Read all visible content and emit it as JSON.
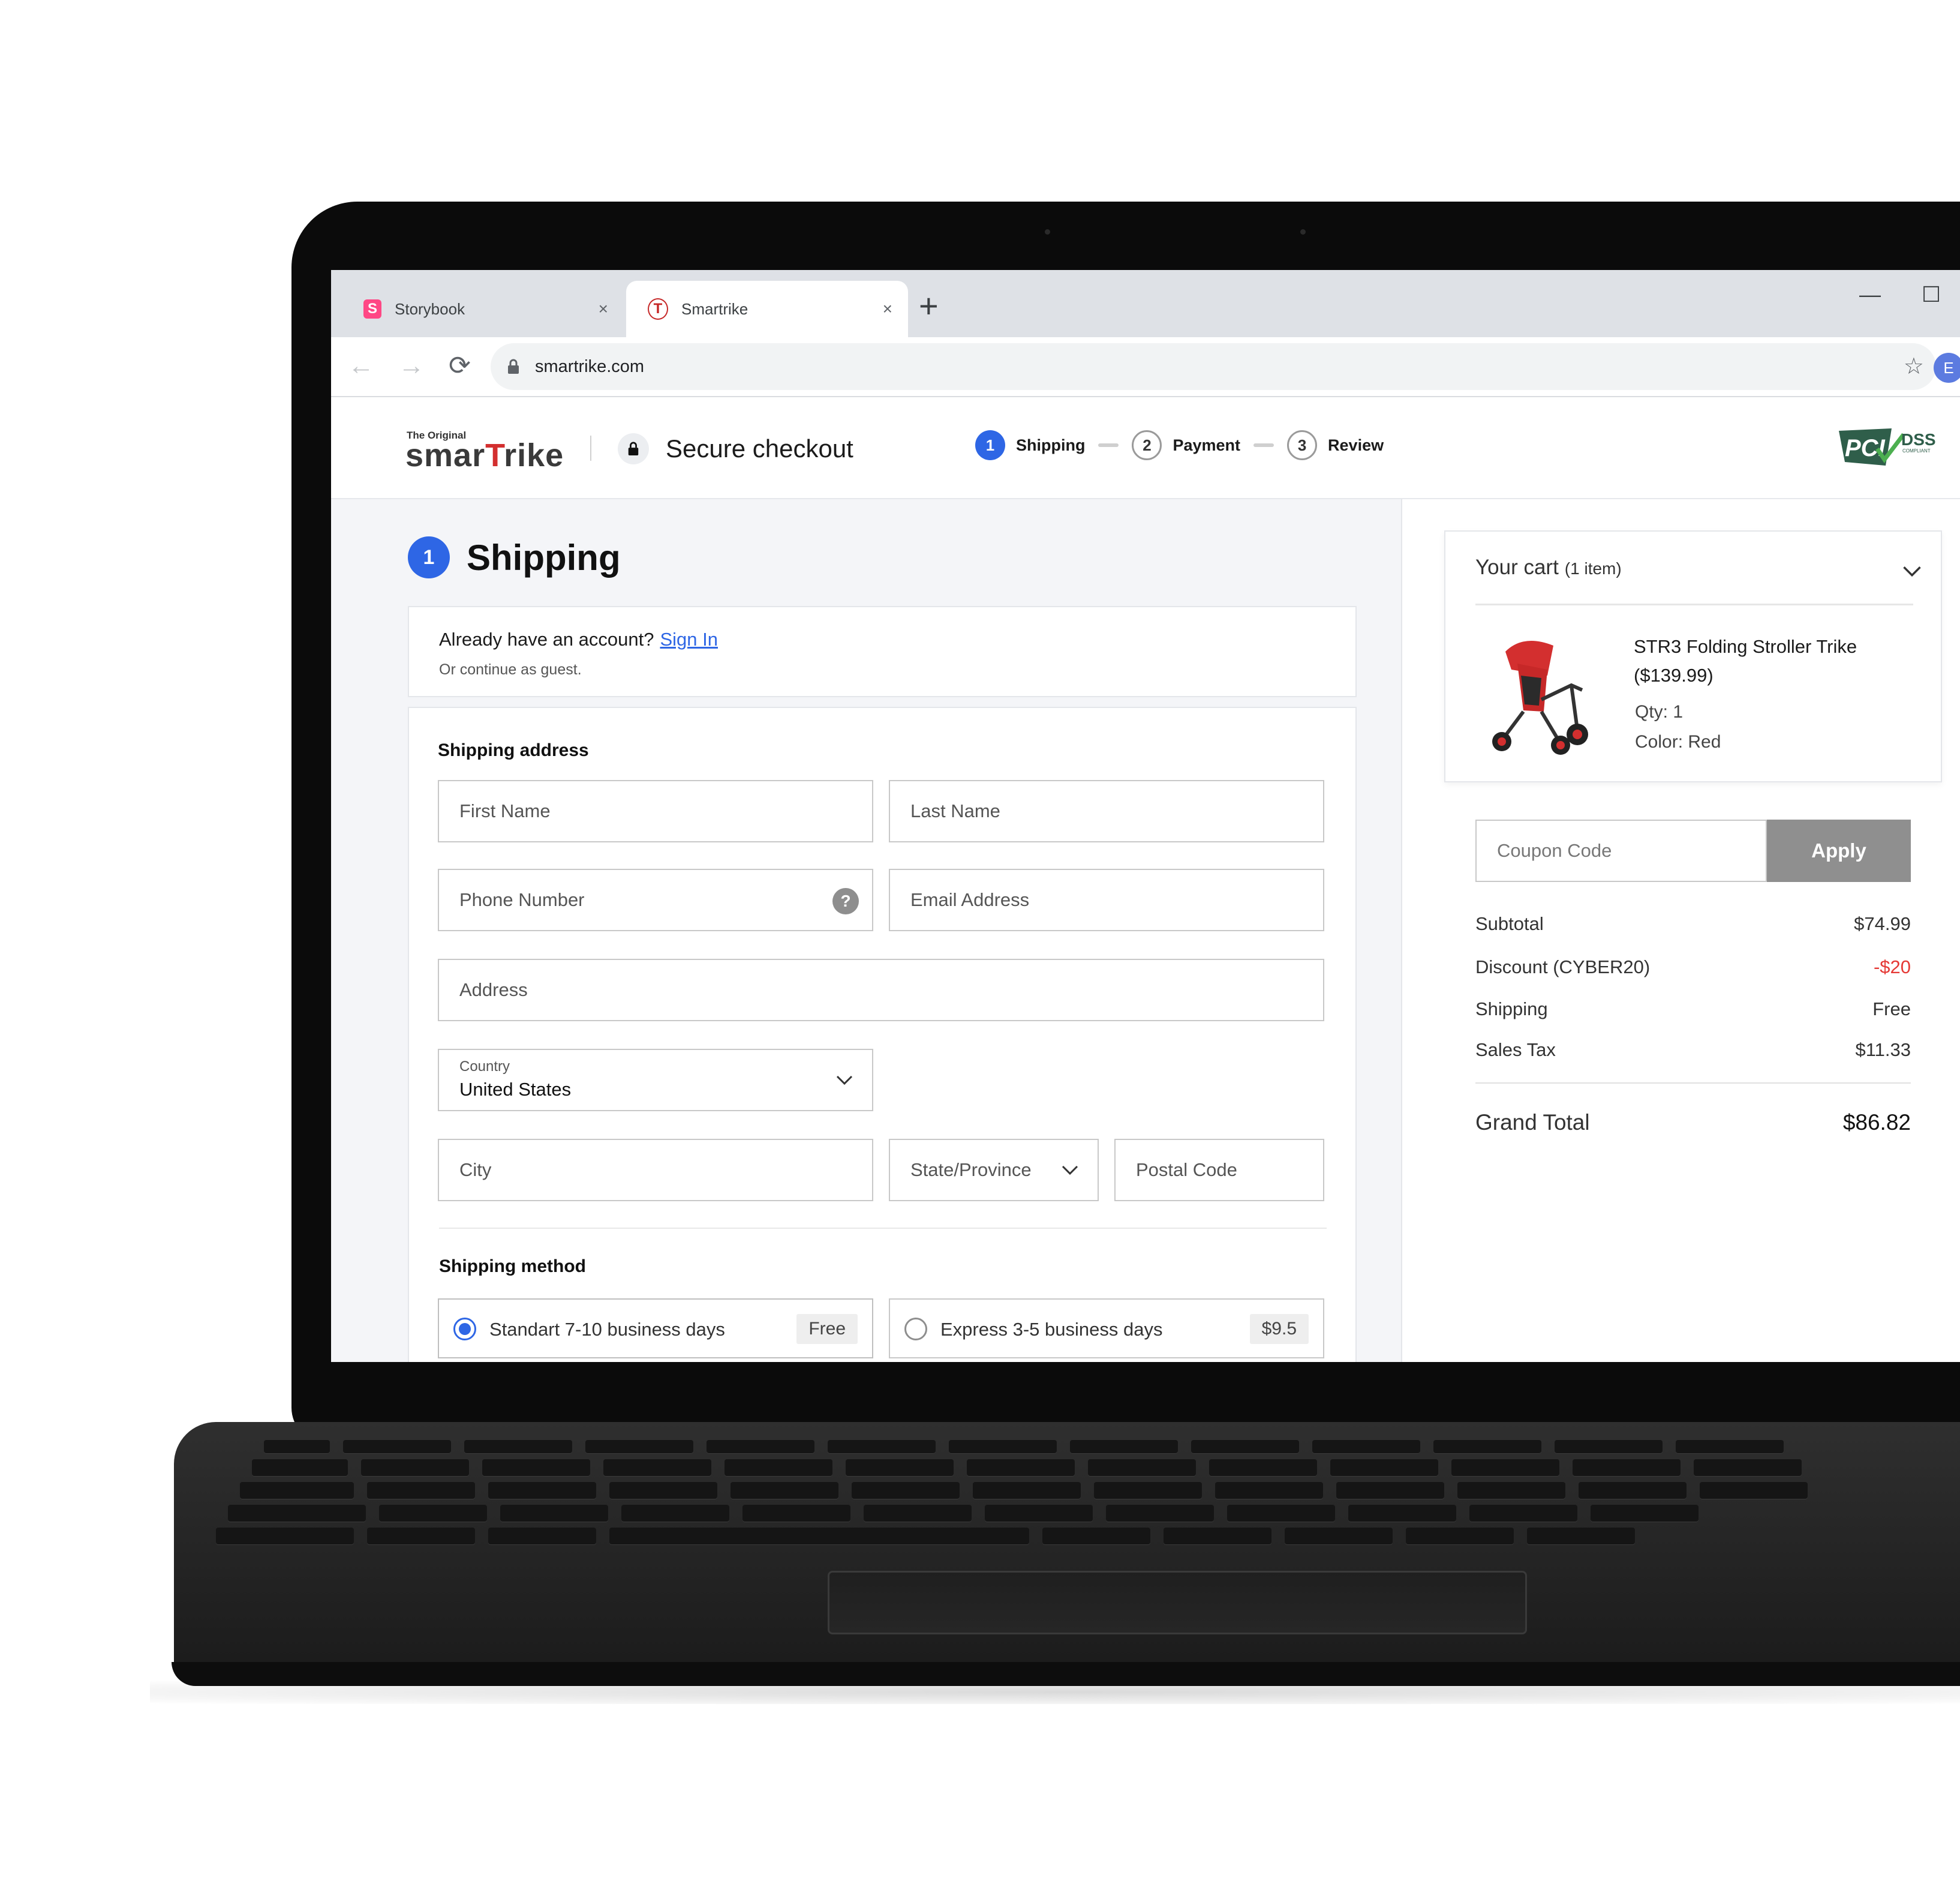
{
  "browser": {
    "tabs": [
      {
        "title": "Storybook",
        "icon": "storybook-icon",
        "favicon_letter": "S",
        "active": false
      },
      {
        "title": "Smartrike",
        "icon": "smartrike-icon",
        "favicon_letter": "T",
        "active": true
      }
    ],
    "new_tab_symbol": "+",
    "close_symbol": "×",
    "url": "smartrike.com",
    "profile_initial": "E"
  },
  "header": {
    "logo_tagline": "The Original",
    "logo_text_a": "smar",
    "logo_text_t": "T",
    "logo_text_b": "rike",
    "secure_checkout": "Secure checkout",
    "steps": [
      {
        "number": "1",
        "label": "Shipping",
        "active": true
      },
      {
        "number": "2",
        "label": "Payment",
        "active": false
      },
      {
        "number": "3",
        "label": "Review",
        "active": false
      }
    ],
    "pci_text": "PCI",
    "pci_dss": "DSS",
    "pci_compliant": "COMPLIANT"
  },
  "shipping": {
    "step_number": "1",
    "title": "Shipping",
    "account_prompt": "Already have an account?",
    "sign_in": "Sign In",
    "guest_text": "Or continue as guest.",
    "address_label": "Shipping address",
    "fields": {
      "first_name": "First Name",
      "last_name": "Last Name",
      "phone": "Phone Number",
      "email": "Email Address",
      "address": "Address",
      "country_label": "Country",
      "country_value": "United States",
      "city": "City",
      "state": "State/Province",
      "postal": "Postal Code"
    },
    "help_symbol": "?",
    "method_label": "Shipping method",
    "methods": [
      {
        "label": "Standart 7-10 business days",
        "price": "Free",
        "selected": true
      },
      {
        "label": "Express 3-5 business days",
        "price": "$9.5",
        "selected": false
      }
    ]
  },
  "cart": {
    "title": "Your cart",
    "count": "(1 item)",
    "item": {
      "name": "STR3 Folding Stroller Trike ($139.99)",
      "qty": "Qty: 1",
      "color": "Color: Red"
    },
    "coupon_placeholder": "Coupon Code",
    "apply": "Apply",
    "summary": [
      {
        "label": "Subtotal",
        "value": "$74.99",
        "highlight": false
      },
      {
        "label": "Discount (CYBER20)",
        "value": "-$20",
        "highlight": true
      },
      {
        "label": "Shipping",
        "value": "Free",
        "highlight": false
      },
      {
        "label": "Sales Tax",
        "value": "$11.33",
        "highlight": false
      }
    ],
    "grand_total_label": "Grand Total",
    "grand_total_value": "$86.82"
  },
  "colors": {
    "accent_blue": "#2e66e5",
    "discount_red": "#e53935",
    "brand_red": "#d32f2f",
    "apply_button_gray": "#8f8f8f"
  }
}
